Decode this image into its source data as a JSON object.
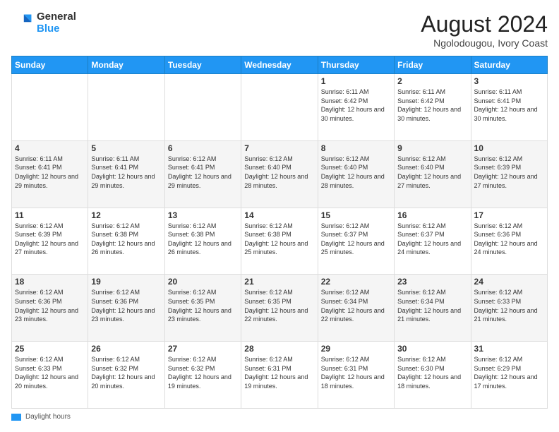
{
  "header": {
    "logo_general": "General",
    "logo_blue": "Blue",
    "month_title": "August 2024",
    "subtitle": "Ngolodougou, Ivory Coast"
  },
  "days_of_week": [
    "Sunday",
    "Monday",
    "Tuesday",
    "Wednesday",
    "Thursday",
    "Friday",
    "Saturday"
  ],
  "legend": "Daylight hours",
  "weeks": [
    [
      {
        "num": "",
        "info": ""
      },
      {
        "num": "",
        "info": ""
      },
      {
        "num": "",
        "info": ""
      },
      {
        "num": "",
        "info": ""
      },
      {
        "num": "1",
        "info": "Sunrise: 6:11 AM\nSunset: 6:42 PM\nDaylight: 12 hours and 30 minutes."
      },
      {
        "num": "2",
        "info": "Sunrise: 6:11 AM\nSunset: 6:42 PM\nDaylight: 12 hours and 30 minutes."
      },
      {
        "num": "3",
        "info": "Sunrise: 6:11 AM\nSunset: 6:41 PM\nDaylight: 12 hours and 30 minutes."
      }
    ],
    [
      {
        "num": "4",
        "info": "Sunrise: 6:11 AM\nSunset: 6:41 PM\nDaylight: 12 hours and 29 minutes."
      },
      {
        "num": "5",
        "info": "Sunrise: 6:11 AM\nSunset: 6:41 PM\nDaylight: 12 hours and 29 minutes."
      },
      {
        "num": "6",
        "info": "Sunrise: 6:12 AM\nSunset: 6:41 PM\nDaylight: 12 hours and 29 minutes."
      },
      {
        "num": "7",
        "info": "Sunrise: 6:12 AM\nSunset: 6:40 PM\nDaylight: 12 hours and 28 minutes."
      },
      {
        "num": "8",
        "info": "Sunrise: 6:12 AM\nSunset: 6:40 PM\nDaylight: 12 hours and 28 minutes."
      },
      {
        "num": "9",
        "info": "Sunrise: 6:12 AM\nSunset: 6:40 PM\nDaylight: 12 hours and 27 minutes."
      },
      {
        "num": "10",
        "info": "Sunrise: 6:12 AM\nSunset: 6:39 PM\nDaylight: 12 hours and 27 minutes."
      }
    ],
    [
      {
        "num": "11",
        "info": "Sunrise: 6:12 AM\nSunset: 6:39 PM\nDaylight: 12 hours and 27 minutes."
      },
      {
        "num": "12",
        "info": "Sunrise: 6:12 AM\nSunset: 6:38 PM\nDaylight: 12 hours and 26 minutes."
      },
      {
        "num": "13",
        "info": "Sunrise: 6:12 AM\nSunset: 6:38 PM\nDaylight: 12 hours and 26 minutes."
      },
      {
        "num": "14",
        "info": "Sunrise: 6:12 AM\nSunset: 6:38 PM\nDaylight: 12 hours and 25 minutes."
      },
      {
        "num": "15",
        "info": "Sunrise: 6:12 AM\nSunset: 6:37 PM\nDaylight: 12 hours and 25 minutes."
      },
      {
        "num": "16",
        "info": "Sunrise: 6:12 AM\nSunset: 6:37 PM\nDaylight: 12 hours and 24 minutes."
      },
      {
        "num": "17",
        "info": "Sunrise: 6:12 AM\nSunset: 6:36 PM\nDaylight: 12 hours and 24 minutes."
      }
    ],
    [
      {
        "num": "18",
        "info": "Sunrise: 6:12 AM\nSunset: 6:36 PM\nDaylight: 12 hours and 23 minutes."
      },
      {
        "num": "19",
        "info": "Sunrise: 6:12 AM\nSunset: 6:36 PM\nDaylight: 12 hours and 23 minutes."
      },
      {
        "num": "20",
        "info": "Sunrise: 6:12 AM\nSunset: 6:35 PM\nDaylight: 12 hours and 23 minutes."
      },
      {
        "num": "21",
        "info": "Sunrise: 6:12 AM\nSunset: 6:35 PM\nDaylight: 12 hours and 22 minutes."
      },
      {
        "num": "22",
        "info": "Sunrise: 6:12 AM\nSunset: 6:34 PM\nDaylight: 12 hours and 22 minutes."
      },
      {
        "num": "23",
        "info": "Sunrise: 6:12 AM\nSunset: 6:34 PM\nDaylight: 12 hours and 21 minutes."
      },
      {
        "num": "24",
        "info": "Sunrise: 6:12 AM\nSunset: 6:33 PM\nDaylight: 12 hours and 21 minutes."
      }
    ],
    [
      {
        "num": "25",
        "info": "Sunrise: 6:12 AM\nSunset: 6:33 PM\nDaylight: 12 hours and 20 minutes."
      },
      {
        "num": "26",
        "info": "Sunrise: 6:12 AM\nSunset: 6:32 PM\nDaylight: 12 hours and 20 minutes."
      },
      {
        "num": "27",
        "info": "Sunrise: 6:12 AM\nSunset: 6:32 PM\nDaylight: 12 hours and 19 minutes."
      },
      {
        "num": "28",
        "info": "Sunrise: 6:12 AM\nSunset: 6:31 PM\nDaylight: 12 hours and 19 minutes."
      },
      {
        "num": "29",
        "info": "Sunrise: 6:12 AM\nSunset: 6:31 PM\nDaylight: 12 hours and 18 minutes."
      },
      {
        "num": "30",
        "info": "Sunrise: 6:12 AM\nSunset: 6:30 PM\nDaylight: 12 hours and 18 minutes."
      },
      {
        "num": "31",
        "info": "Sunrise: 6:12 AM\nSunset: 6:29 PM\nDaylight: 12 hours and 17 minutes."
      }
    ]
  ]
}
